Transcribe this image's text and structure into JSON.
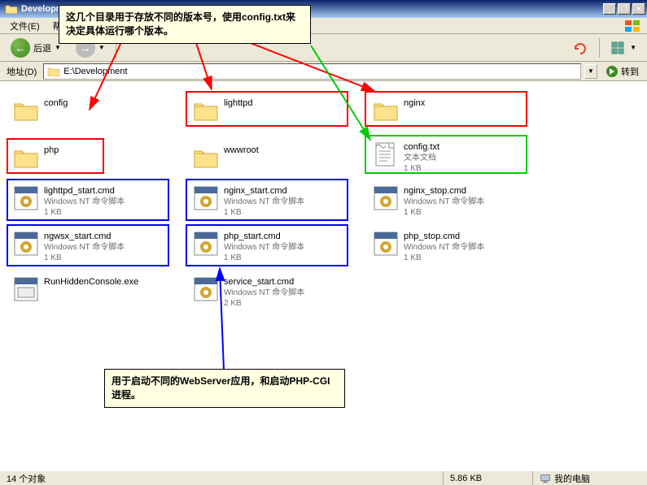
{
  "titlebar": {
    "title": "Developm"
  },
  "menu": {
    "file": "文件(E)",
    "help": "帮"
  },
  "toolbar": {
    "back": "后退"
  },
  "address": {
    "label": "地址(D)",
    "path": "E:\\Development",
    "go": "转到"
  },
  "annotations": {
    "top": "这几个目录用于存放不同的版本号，使用config.txt来决定具体运行哪个版本。",
    "bottom": "用于启动不同的WebServer应用，和启动PHP-CGI进程。"
  },
  "items": {
    "config": {
      "name": "config"
    },
    "lighttpd": {
      "name": "lighttpd"
    },
    "nginx": {
      "name": "nginx"
    },
    "php": {
      "name": "php"
    },
    "wwwroot": {
      "name": "wwwroot"
    },
    "configtxt": {
      "name": "config.txt",
      "type": "文本文档",
      "size": "1 KB"
    },
    "lighttpd_start": {
      "name": "lighttpd_start.cmd",
      "type": "Windows NT 命令脚本",
      "size": "1 KB"
    },
    "nginx_start": {
      "name": "nginx_start.cmd",
      "type": "Windows NT 命令脚本",
      "size": "1 KB"
    },
    "nginx_stop": {
      "name": "nginx_stop.cmd",
      "type": "Windows NT 命令脚本",
      "size": "1 KB"
    },
    "ngwsx_start": {
      "name": "ngwsx_start.cmd",
      "type": "Windows NT 命令脚本",
      "size": "1 KB"
    },
    "php_start": {
      "name": "php_start.cmd",
      "type": "Windows NT 命令脚本",
      "size": "1 KB"
    },
    "php_stop": {
      "name": "php_stop.cmd",
      "type": "Windows NT 命令脚本",
      "size": "1 KB"
    },
    "runhidden": {
      "name": "RunHiddenConsole.exe"
    },
    "service_start": {
      "name": "service_start.cmd",
      "type": "Windows NT 命令脚本",
      "size": "2 KB"
    }
  },
  "status": {
    "count": "14 个对象",
    "size": "5.86 KB",
    "location": "我的电脑"
  }
}
